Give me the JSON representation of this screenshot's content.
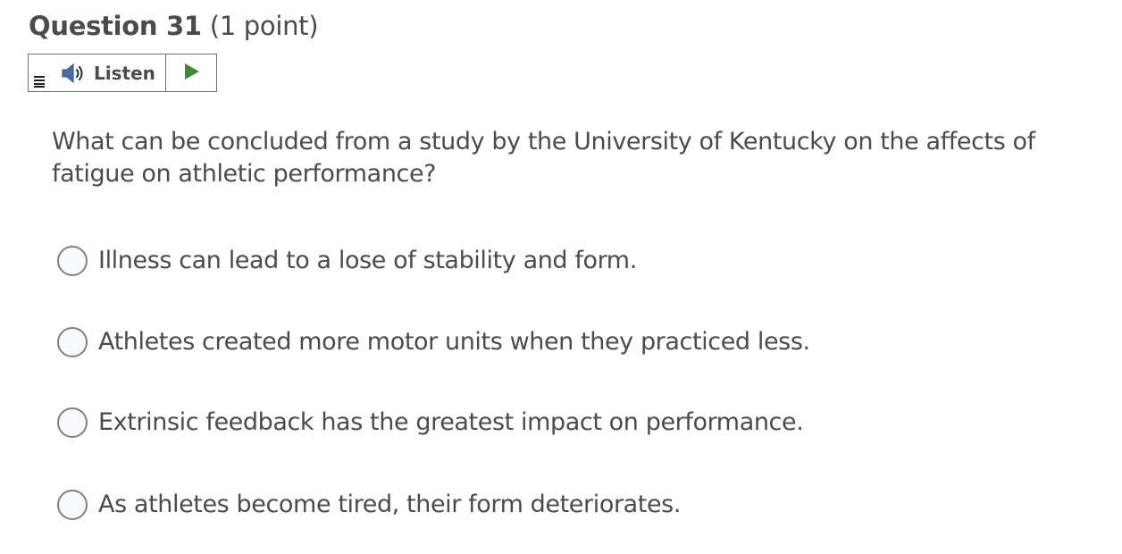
{
  "question": {
    "title": "Question 31",
    "points": "(1 point)",
    "text": "What can be concluded from a study by the University of Kentucky on the affects of fatigue on athletic performance?"
  },
  "listen_widget": {
    "label": "Listen",
    "speaker_icon": "speaker-icon",
    "play_icon": "play-icon",
    "menu_icon": "menu-icon",
    "play_color": "#3d8a3d"
  },
  "choices": [
    {
      "label": "Illness can lead to a lose of stability and form.",
      "selected": false
    },
    {
      "label": "Athletes created more motor units when they practiced less.",
      "selected": false
    },
    {
      "label": "Extrinsic feedback has the greatest impact on performance.",
      "selected": false
    },
    {
      "label": "As athletes become tired, their form deteriorates.",
      "selected": false
    }
  ]
}
